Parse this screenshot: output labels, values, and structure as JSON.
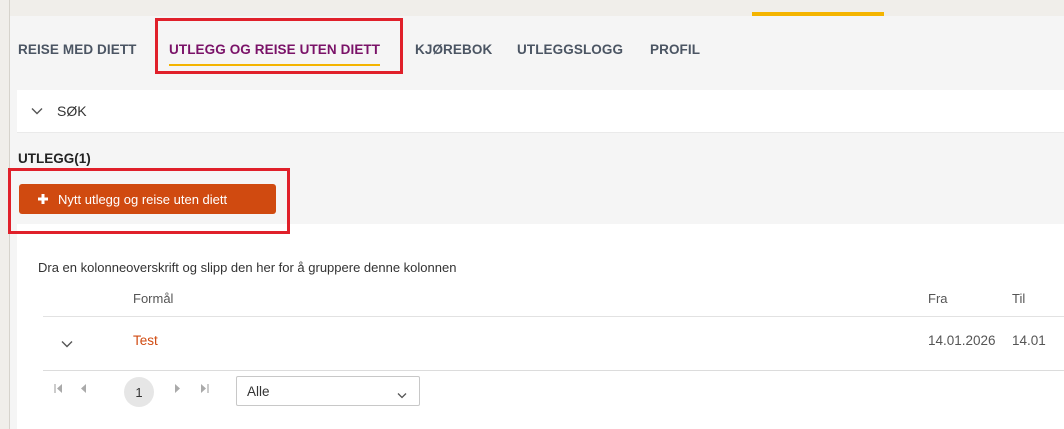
{
  "tabs": [
    {
      "label": "REISE MED DIETT"
    },
    {
      "label": "UTLEGG OG REISE UTEN DIETT"
    },
    {
      "label": "KJØREBOK"
    },
    {
      "label": "UTLEGGSLOGG"
    },
    {
      "label": "PROFIL"
    }
  ],
  "search": {
    "label": "SØK"
  },
  "section": {
    "title": "UTLEGG(1)"
  },
  "actions": {
    "new_label": "Nytt utlegg og reise uten diett"
  },
  "grid": {
    "group_hint": "Dra en kolonneoverskrift og slipp den her for å gruppere denne kolonnen",
    "columns": [
      "Formål",
      "Fra",
      "Til"
    ],
    "rows": [
      {
        "formal": "Test",
        "fra": "14.01.2026",
        "til": "14.01"
      }
    ]
  },
  "pager": {
    "current_page": "1",
    "page_size": "Alle"
  },
  "colors": {
    "accent_orange": "#d04a10",
    "active_tab": "#7a1268",
    "underline_yellow": "#f4b400",
    "highlight_red": "#e0202a"
  }
}
